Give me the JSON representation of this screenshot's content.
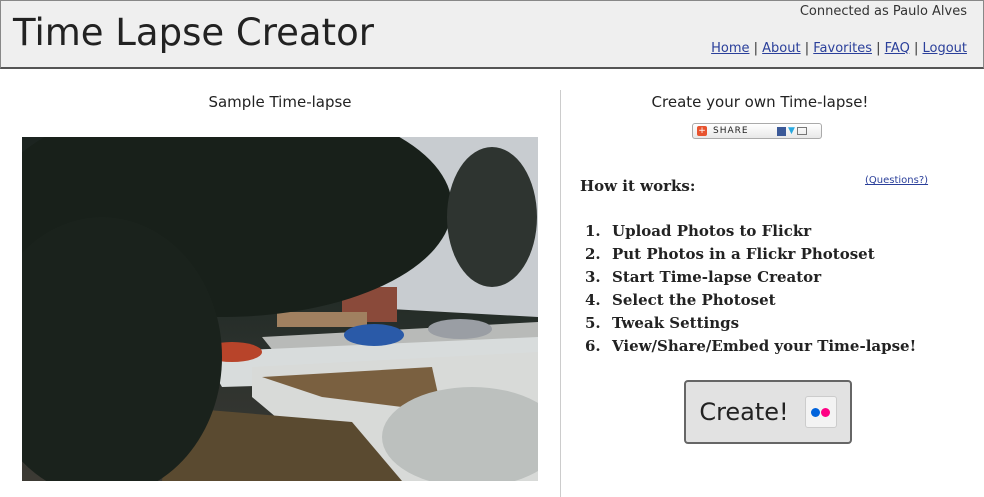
{
  "header": {
    "title": "Time Lapse Creator",
    "user": "Connected as Paulo Alves",
    "nav": [
      "Home",
      "About",
      "Favorites",
      "FAQ",
      "Logout"
    ]
  },
  "left": {
    "heading": "Sample Time-lapse"
  },
  "right": {
    "heading": "Create your own Time-lapse!",
    "share_label": "SHARE",
    "how_title": "How it works:",
    "questions_link": "(Questions?)",
    "steps": [
      {
        "n": "1.",
        "t": "Upload Photos to Flickr"
      },
      {
        "n": "2.",
        "t": "Put Photos in a Flickr Photoset"
      },
      {
        "n": "3.",
        "t": "Start Time-lapse Creator"
      },
      {
        "n": "4.",
        "t": "Select the Photoset"
      },
      {
        "n": "5.",
        "t": "Tweak Settings"
      },
      {
        "n": "6.",
        "t": "View/Share/Embed your Time-lapse!"
      }
    ],
    "create_label": "Create!"
  },
  "colors": {
    "link": "#2a3f9a",
    "flickr_blue": "#0063dc",
    "flickr_pink": "#ff0084"
  }
}
